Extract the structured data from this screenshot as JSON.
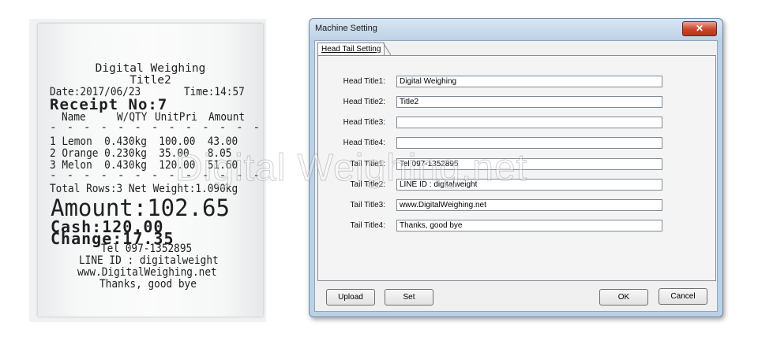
{
  "receipt": {
    "header_line1": "Digital Weighing",
    "header_line2": "Title2",
    "date": "Date:2017/06/23",
    "time": "Time:14:57",
    "receipt_no": "Receipt No:7",
    "columns": [
      "Name",
      "W/QTY",
      "UnitPri",
      "Amount"
    ],
    "divider": "- - - - - - - - - - - - -",
    "items": [
      {
        "line": "1 Lemon  0.430kg  100.00  43.00"
      },
      {
        "line": "2 Orange 0.230kg  35.00   8.05"
      },
      {
        "line": "3 Melon  0.430kg  120.00  51.60"
      }
    ],
    "total_rows": "Total Rows:3 Net Weight:1.090kg",
    "amount": "Amount:102.65",
    "cash": "Cash:120.00",
    "change": "Change:17.35",
    "tail1": "Tel 097-1352895",
    "tail2": "LINE ID : digitalweight",
    "tail3": "www.DigitalWeighing.net",
    "tail4": "Thanks, good bye"
  },
  "window": {
    "title": "Machine Setting",
    "close_glyph": "✕",
    "tab_label_a": "Head",
    "tab_label_b": "Tail Setting",
    "rows": [
      {
        "label": "Head Title1:",
        "value": "Digital Weighing"
      },
      {
        "label": "Head Title2:",
        "value": "Title2"
      },
      {
        "label": "Head Title3:",
        "value": ""
      },
      {
        "label": "Head Title4:",
        "value": ""
      },
      {
        "label": "Tail Title1:",
        "value": "Tel 097-1352895"
      },
      {
        "label": "Tail Title2:",
        "value": "LINE ID : digitalweight"
      },
      {
        "label": "Tail Title3:",
        "value": "www.DigitalWeighing.net"
      },
      {
        "label": "Tail Title4:",
        "value": "Thanks, good bye"
      }
    ],
    "buttons": {
      "upload": "Upload",
      "set": "Set",
      "ok": "OK",
      "cancel": "Cancel"
    }
  },
  "watermark": "Digital Weighing.net"
}
